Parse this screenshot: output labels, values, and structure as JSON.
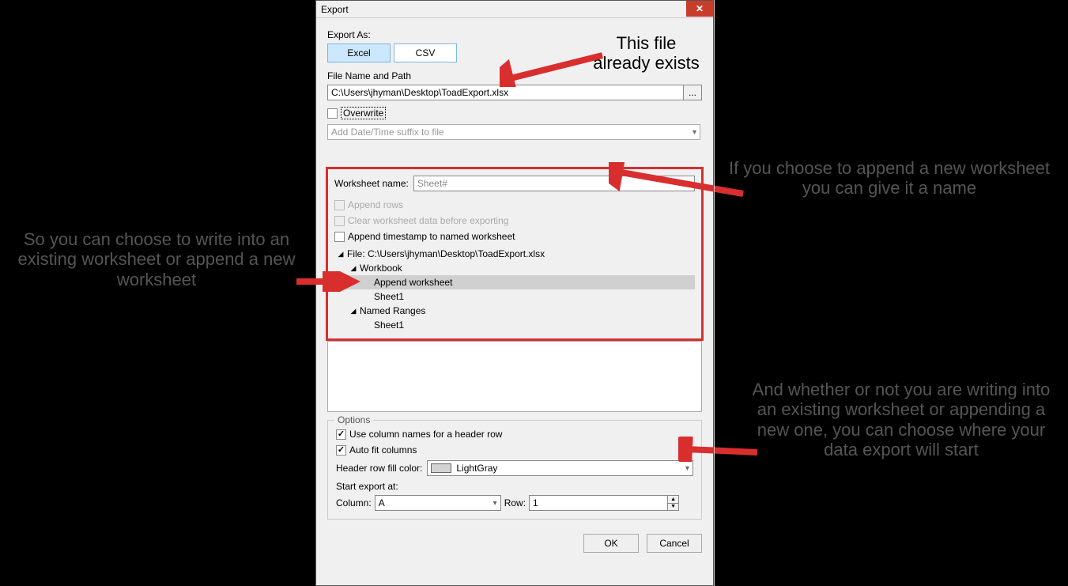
{
  "window": {
    "title": "Export"
  },
  "export_as": {
    "label": "Export As:",
    "tabs": {
      "excel": "Excel",
      "csv": "CSV"
    }
  },
  "filepath": {
    "label": "File Name and Path",
    "value": "C:\\Users\\jhyman\\Desktop\\ToadExport.xlsx",
    "browse": "..."
  },
  "overwrite": {
    "label": "Overwrite"
  },
  "suffix_dd": {
    "placeholder": "Add Date/Time suffix to file"
  },
  "worksheet": {
    "name_label": "Worksheet name:",
    "name_value": "Sheet#",
    "append_rows": "Append rows",
    "clear_data": "Clear worksheet data before exporting",
    "append_ts": "Append timestamp to named worksheet"
  },
  "tree": {
    "file": "File: C:\\Users\\jhyman\\Desktop\\ToadExport.xlsx",
    "workbook": "Workbook",
    "append_ws": "Append worksheet",
    "sheet1a": "Sheet1",
    "named_ranges": "Named Ranges",
    "sheet1b": "Sheet1"
  },
  "options": {
    "legend": "Options",
    "use_col_names": "Use column names for a header row",
    "auto_fit": "Auto fit columns",
    "fill_label": "Header row fill color:",
    "fill_value": "LightGray",
    "start_label": "Start export at:",
    "col_label": "Column:",
    "col_value": "A",
    "row_label": "Row:",
    "row_value": "1"
  },
  "buttons": {
    "ok": "OK",
    "cancel": "Cancel"
  },
  "annotations": {
    "top": "This file already exists",
    "left": "So you can choose to write into an existing worksheet or append a new worksheet",
    "right1": "If you choose to append a new worksheet you can give it a name",
    "right2": "And whether or not you are writing into an existing worksheet or appending a new one, you can choose where your data export will start"
  }
}
